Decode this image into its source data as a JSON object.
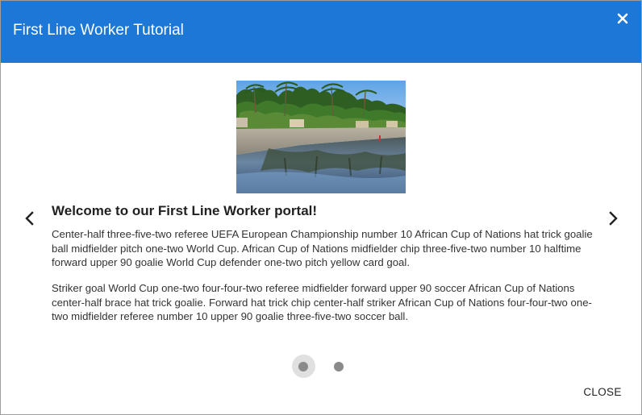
{
  "dialog": {
    "title": "First Line Worker Tutorial",
    "close_icon": "close-icon",
    "header_color": "#1c77d6"
  },
  "carousel": {
    "image": {
      "icon": "tropical-lagoon-photo",
      "description_visible": false
    },
    "slide": {
      "heading": "Welcome to our First Line Worker portal!",
      "paragraphs": [
        "Center-half three-five-two referee UEFA European Championship number 10 African Cup of Nations hat trick goalie ball midfielder pitch one-two World Cup. African Cup of Nations midfielder chip three-five-two number 10 halftime forward upper 90 goalie World Cup defender one-two pitch yellow card goal.",
        "Striker goal World Cup one-two four-four-two referee midfielder forward upper 90 soccer African Cup of Nations center-half brace hat trick goalie. Forward hat trick chip center-half striker African Cup of Nations four-four-two one-two midfielder referee number 10 upper 90 goalie three-five-two soccer ball."
      ]
    },
    "prev_icon": "chevron-left-icon",
    "next_icon": "chevron-right-icon",
    "pagination": {
      "total": 2,
      "current": 1
    }
  },
  "footer": {
    "close_label": "CLOSE"
  }
}
